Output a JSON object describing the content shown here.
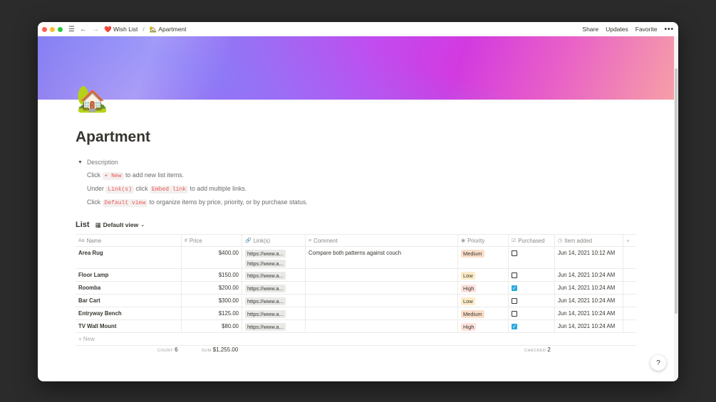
{
  "titlebar": {
    "breadcrumb": [
      {
        "icon": "❤️",
        "label": "Wish List"
      },
      {
        "icon": "🏡",
        "label": "Apartment"
      }
    ],
    "share": "Share",
    "updates": "Updates",
    "favorite": "Favorite",
    "more": "•••"
  },
  "page": {
    "icon": "🏡",
    "title": "Apartment"
  },
  "description": {
    "toggle_label": "Description",
    "line1": {
      "pre": "Click",
      "code": "+ New",
      "post": "to add new list items."
    },
    "line2": {
      "pre": "Under",
      "code1": "Link(s)",
      "mid": "click",
      "code2": "Embed link",
      "post": "to add multiple links."
    },
    "line3": {
      "pre": "Click",
      "code": "Default view",
      "post": "to organize items by price, priority, or by purchase status."
    }
  },
  "list": {
    "title": "List",
    "view_label": "Default view",
    "columns": [
      "Name",
      "Price",
      "Link(s)",
      "Comment",
      "Priority",
      "Purchased",
      "Item added"
    ],
    "rows": [
      {
        "name": "Area Rug",
        "price": "$400.00",
        "links": [
          "https://www.a...",
          "https://www.a..."
        ],
        "comment": "Compare both patterns against couch",
        "priority": "Medium",
        "purchased": false,
        "added": "Jun 14, 2021 10:12 AM"
      },
      {
        "name": "Floor Lamp",
        "price": "$150.00",
        "links": [
          "https://www.a..."
        ],
        "comment": "",
        "priority": "Low",
        "purchased": false,
        "added": "Jun 14, 2021 10:24 AM"
      },
      {
        "name": "Roomba",
        "price": "$200.00",
        "links": [
          "https://www.a..."
        ],
        "comment": "",
        "priority": "High",
        "purchased": true,
        "added": "Jun 14, 2021 10:24 AM"
      },
      {
        "name": "Bar Cart",
        "price": "$300.00",
        "links": [
          "https://www.a..."
        ],
        "comment": "",
        "priority": "Low",
        "purchased": false,
        "added": "Jun 14, 2021 10:24 AM"
      },
      {
        "name": "Entryway Bench",
        "price": "$125.00",
        "links": [
          "https://www.a..."
        ],
        "comment": "",
        "priority": "Medium",
        "purchased": false,
        "added": "Jun 14, 2021 10:24 AM"
      },
      {
        "name": "TV Wall Mount",
        "price": "$80.00",
        "links": [
          "https://www.a..."
        ],
        "comment": "",
        "priority": "High",
        "purchased": true,
        "added": "Jun 14, 2021 10:24 AM"
      }
    ],
    "new_label": "+ New",
    "footer": {
      "count_label": "COUNT",
      "count_value": "6",
      "sum_label": "SUM",
      "sum_value": "$1,255.00",
      "checked_label": "CHECKED",
      "checked_value": "2"
    }
  },
  "help": "?"
}
